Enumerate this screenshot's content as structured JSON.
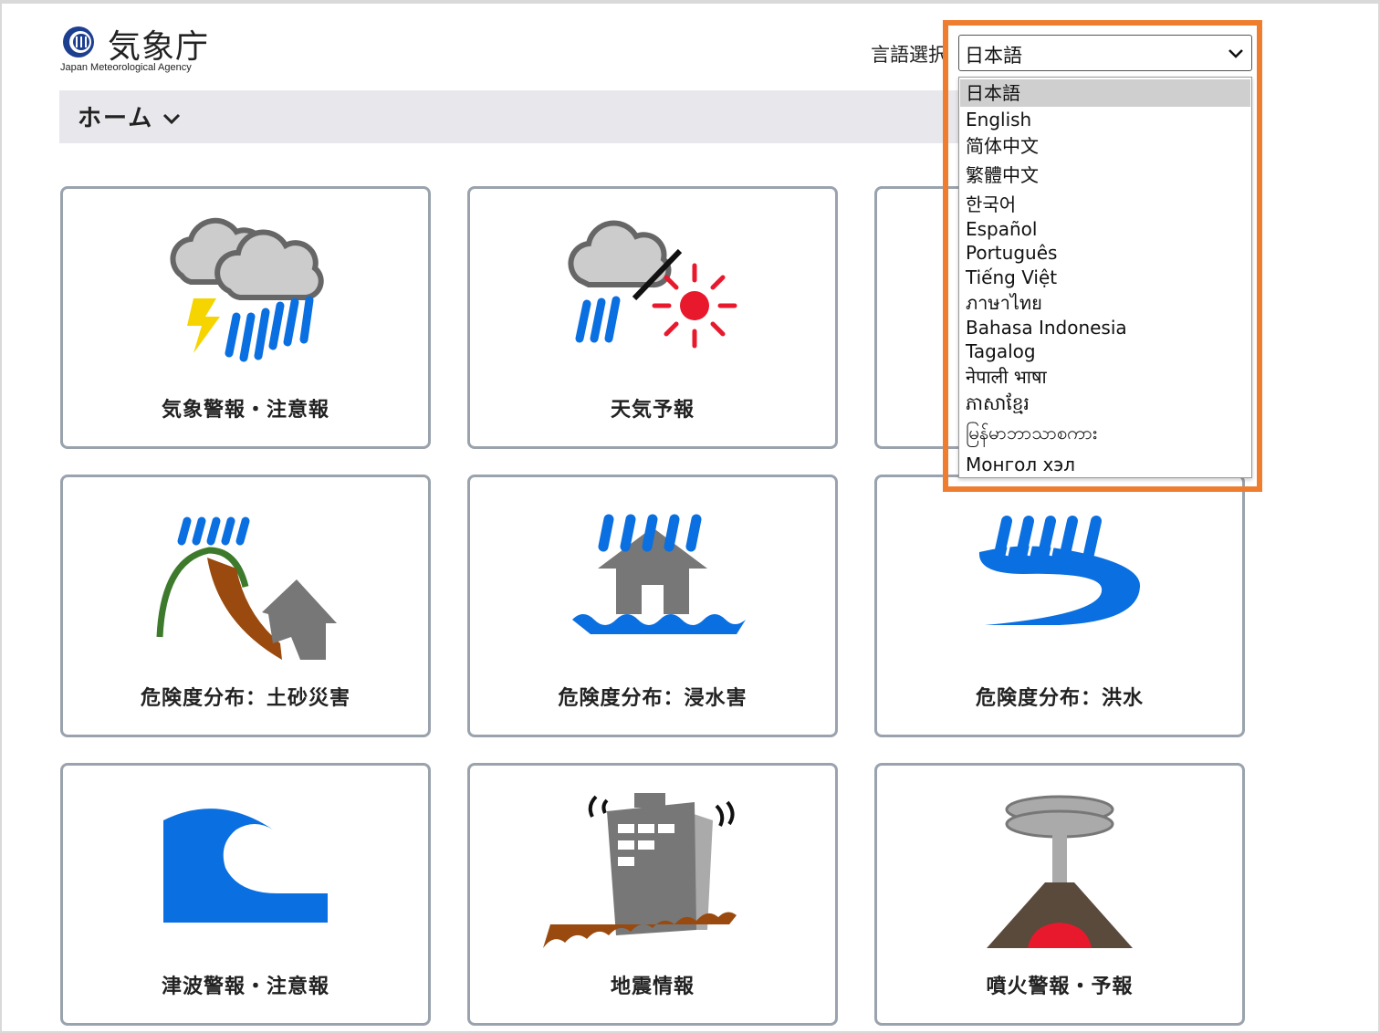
{
  "header": {
    "logo_text": "気象庁",
    "logo_subtitle": "Japan Meteorological Agency",
    "language_label": "言語選択"
  },
  "nav": {
    "home_label": "ホーム"
  },
  "language_select": {
    "selected": "日本語",
    "options": [
      "日本語",
      "English",
      "简体中文",
      "繁體中文",
      "한국어",
      "Español",
      "Português",
      "Tiếng Việt",
      "ภาษาไทย",
      "Bahasa Indonesia",
      "Tagalog",
      "नेपाली भाषा",
      "ភាសាខ្មែរ",
      "မြန်မာဘာသာစကား",
      "Монгол хэл"
    ]
  },
  "tiles": [
    {
      "label": "気象警報・注意報",
      "icon": "storm-icon"
    },
    {
      "label": "天気予報",
      "icon": "forecast-icon"
    },
    {
      "label": "",
      "icon": "hidden-tile"
    },
    {
      "label": "危険度分布：土砂災害",
      "icon": "landslide-icon"
    },
    {
      "label": "危険度分布：浸水害",
      "icon": "inundation-icon"
    },
    {
      "label": "危険度分布：洪水",
      "icon": "flood-icon"
    },
    {
      "label": "津波警報・注意報",
      "icon": "tsunami-icon"
    },
    {
      "label": "地震情報",
      "icon": "earthquake-icon"
    },
    {
      "label": "噴火警報・予報",
      "icon": "volcano-icon"
    }
  ],
  "colors": {
    "highlight": "#ef7d2f",
    "rain_blue": "#0a6fe0",
    "tile_border": "#9aa3ad",
    "navbar_bg": "#e8e8ec"
  }
}
